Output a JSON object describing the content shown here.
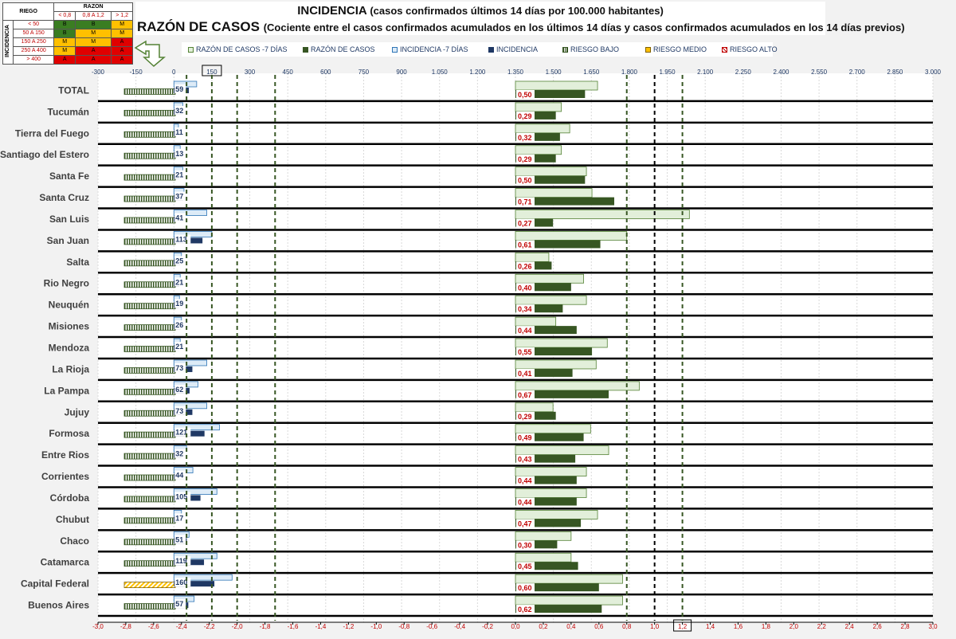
{
  "title": {
    "main": "INCIDENCIA",
    "main_sub": "(casos confirmados últimos 14 días por 100.000 habitantes)",
    "second": "RAZÓN DE CASOS",
    "second_sub": "(Cociente entre el casos confirmados acumulados en los últimos 14 días y casos confirmados acumulados en los 14 días previos)"
  },
  "risk_table": {
    "riesgo": "RIEGO",
    "razon": "RAZON",
    "incidencia": "INCIDENCIA",
    "razon_cols": [
      "< 0,8",
      "0,8 A 1,2",
      "> 1,2"
    ],
    "rows": [
      {
        "label": "< 50",
        "cells": [
          "B",
          "B",
          "M"
        ]
      },
      {
        "label": "50 A 150",
        "cells": [
          "B",
          "M",
          "M"
        ]
      },
      {
        "label": "150 A 250",
        "cells": [
          "M",
          "M",
          "A"
        ]
      },
      {
        "label": "250 A 400",
        "cells": [
          "M",
          "A",
          "A"
        ]
      },
      {
        "label": "> 400",
        "cells": [
          "A",
          "A",
          "A"
        ]
      }
    ]
  },
  "legend": [
    {
      "label": "RAZÓN DE CASOS -7 DÍAS",
      "color": "#e2efda",
      "border": "#548235",
      "pattern": "none"
    },
    {
      "label": "RAZÓN DE CASOS",
      "color": "#375623",
      "border": "#375623",
      "pattern": "none"
    },
    {
      "label": "INCIDENCIA -7 DÍAS",
      "color": "#ddebf7",
      "border": "#2e75b6",
      "pattern": "none"
    },
    {
      "label": "INCIDENCIA",
      "color": "#1f3864",
      "border": "#1f3864",
      "pattern": "none"
    },
    {
      "label": "RIESGO BAJO",
      "color": "#375623",
      "border": "#375623",
      "pattern": "stripe"
    },
    {
      "label": "RIESGO MEDIO",
      "color": "#ffc000",
      "border": "#806000",
      "pattern": "none"
    },
    {
      "label": "RIESGO ALTO",
      "color": "#c00000",
      "border": "#c00000",
      "pattern": "diag"
    }
  ],
  "chart_data": {
    "type": "bar",
    "orientation": "horizontal",
    "categories": [
      "TOTAL",
      "Tucumán",
      "Tierra del Fuego",
      "Santiago del Estero",
      "Santa Fe",
      "Santa Cruz",
      "San Luis",
      "San Juan",
      "Salta",
      "Rio Negro",
      "Neuquén",
      "Misiones",
      "Mendoza",
      "La Rioja",
      "La Pampa",
      "Jujuy",
      "Formosa",
      "Entre Rios",
      "Corrientes",
      "Córdoba",
      "Chubut",
      "Chaco",
      "Catamarca",
      "Capital Federal",
      "Buenos Aires"
    ],
    "incidencia": [
      59,
      32,
      11,
      13,
      21,
      37,
      41,
      113,
      25,
      21,
      19,
      26,
      21,
      73,
      62,
      73,
      121,
      32,
      44,
      105,
      17,
      51,
      119,
      160,
      57
    ],
    "incidencia_labels": [
      "59",
      "32",
      "11",
      "13",
      "21",
      "37",
      "41",
      "113",
      "25",
      "21",
      "19",
      "26",
      "21",
      "73",
      "62",
      "73",
      "121",
      "32",
      "44",
      "105",
      "17",
      "51",
      "119",
      "160",
      "57"
    ],
    "incidencia_7dias": [
      90,
      35,
      18,
      25,
      35,
      40,
      130,
      150,
      30,
      25,
      22,
      30,
      25,
      130,
      95,
      130,
      180,
      50,
      75,
      170,
      30,
      60,
      170,
      230,
      80
    ],
    "razon": [
      0.5,
      0.29,
      0.32,
      0.29,
      0.5,
      0.71,
      0.27,
      0.61,
      0.26,
      0.4,
      0.34,
      0.44,
      0.55,
      0.41,
      0.67,
      0.29,
      0.49,
      0.43,
      0.44,
      0.44,
      0.47,
      0.3,
      0.45,
      0.6,
      0.62
    ],
    "razon_labels": [
      "0,50",
      "0,29",
      "0,32",
      "0,29",
      "0,50",
      "0,71",
      "0,27",
      "0,61",
      "0,26",
      "0,40",
      "0,34",
      "0,44",
      "0,55",
      "0,41",
      "0,67",
      "0,29",
      "0,49",
      "0,43",
      "0,44",
      "0,44",
      "0,47",
      "0,30",
      "0,45",
      "0,60",
      "0,62"
    ],
    "razon_7dias": [
      0.59,
      0.33,
      0.39,
      0.33,
      0.51,
      0.55,
      1.25,
      0.8,
      0.24,
      0.49,
      0.51,
      0.29,
      0.66,
      0.58,
      0.89,
      0.27,
      0.54,
      0.67,
      0.51,
      0.51,
      0.59,
      0.4,
      0.4,
      0.77,
      0.77
    ],
    "riesgo": [
      "B",
      "B",
      "B",
      "B",
      "B",
      "B",
      "B",
      "B",
      "B",
      "B",
      "B",
      "B",
      "B",
      "B",
      "B",
      "B",
      "B",
      "B",
      "B",
      "B",
      "B",
      "B",
      "B",
      "M",
      "B"
    ],
    "top_axis": {
      "range": [
        -300,
        3000
      ],
      "ticks": [
        -300,
        -150,
        0,
        150,
        300,
        450,
        600,
        750,
        900,
        1050,
        1200,
        1350,
        1500,
        1650,
        1800,
        1950,
        2100,
        2250,
        2400,
        2550,
        2700,
        2850,
        3000
      ],
      "tick_labels": [
        "-300",
        "-150",
        "0",
        "150",
        "300",
        "450",
        "600",
        "750",
        "900",
        "1.050",
        "1.200",
        "1.350",
        "1.500",
        "1.650",
        "1.800",
        "1.950",
        "2.100",
        "2.250",
        "2.400",
        "2.550",
        "2.700",
        "2.850",
        "3.000"
      ],
      "boxed": "150"
    },
    "bottom_axis": {
      "range": [
        -3.0,
        3.0
      ],
      "ticks": [
        -3,
        -2.8,
        -2.6,
        -2.4,
        -2.2,
        -2,
        -1.8,
        -1.6,
        -1.4,
        -1.2,
        -1,
        -0.8,
        -0.6,
        -0.4,
        -0.2,
        0,
        0.2,
        0.4,
        0.6,
        0.8,
        1,
        1.2,
        1.4,
        1.6,
        1.8,
        2,
        2.2,
        2.4,
        2.6,
        2.8,
        3
      ],
      "tick_labels": [
        "-3,0",
        "-2,8",
        "-2,6",
        "-2,4",
        "-2,2",
        "-2,0",
        "-1,8",
        "-1,6",
        "-1,4",
        "-1,2",
        "-1,0",
        "-0,8",
        "-0,6",
        "-0,4",
        "-0,2",
        "0,0",
        "0,2",
        "0,4",
        "0,6",
        "0,8",
        "1,0",
        "1,2",
        "1,4",
        "1,6",
        "1,8",
        "2,0",
        "2,2",
        "2,4",
        "2,6",
        "2,8",
        "3,0"
      ],
      "boxed": "1,2"
    },
    "threshold_lines": {
      "incidencia": [
        50,
        150,
        250,
        400
      ],
      "razon": [
        0.8,
        1.0,
        1.2
      ]
    }
  }
}
